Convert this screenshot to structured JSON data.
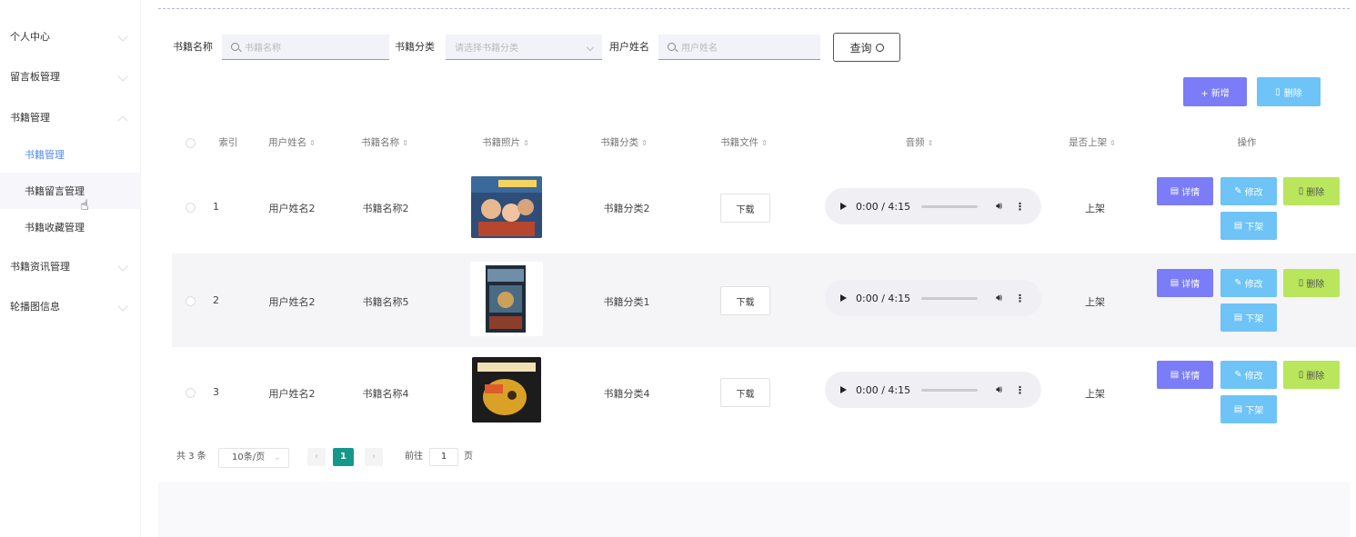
{
  "sidebar": {
    "items": [
      {
        "label": "个人中心"
      },
      {
        "label": "留言板管理"
      },
      {
        "label": "书籍管理"
      },
      {
        "label": "书籍资讯管理"
      },
      {
        "label": "轮播图信息"
      }
    ],
    "sub_items": [
      {
        "label": "书籍管理",
        "active": true
      },
      {
        "label": "书籍留言管理"
      },
      {
        "label": "书籍收藏管理"
      }
    ]
  },
  "search": {
    "book_name_label": "书籍名称",
    "book_name_placeholder": "书籍名称",
    "category_label": "书籍分类",
    "category_placeholder": "请选择书籍分类",
    "user_name_label": "用户姓名",
    "user_name_placeholder": "用户姓名",
    "query_label": "查询"
  },
  "toolbar": {
    "add_label": "+ 新增",
    "delete_label": "删除"
  },
  "table": {
    "columns": [
      "索引",
      "用户姓名",
      "书籍名称",
      "书籍照片",
      "书籍分类",
      "书籍文件",
      "音频",
      "是否上架",
      "操作"
    ],
    "rows": [
      {
        "index": "1",
        "user": "用户姓名2",
        "book": "书籍名称2",
        "category": "书籍分类2",
        "file_btn": "下载",
        "audio_time": "0:00 / 4:15",
        "listed": "上架"
      },
      {
        "index": "2",
        "user": "用户姓名2",
        "book": "书籍名称5",
        "category": "书籍分类1",
        "file_btn": "下载",
        "audio_time": "0:00 / 4:15",
        "listed": "上架"
      },
      {
        "index": "3",
        "user": "用户姓名2",
        "book": "书籍名称4",
        "category": "书籍分类4",
        "file_btn": "下载",
        "audio_time": "0:00 / 4:15",
        "listed": "上架"
      }
    ],
    "ops": {
      "detail": "详情",
      "edit": "修改",
      "delete": "删除",
      "delist": "下架"
    }
  },
  "pagination": {
    "total": "共 3 条",
    "page_size": "10条/页",
    "current_page": "1",
    "goto_label": "前往",
    "goto_value": "1",
    "page_suffix": "页"
  },
  "colors": {
    "primary_purple": "#7b7cf7",
    "blue": "#6ec3f7",
    "green": "#b9e65c",
    "teal": "#15988a"
  }
}
